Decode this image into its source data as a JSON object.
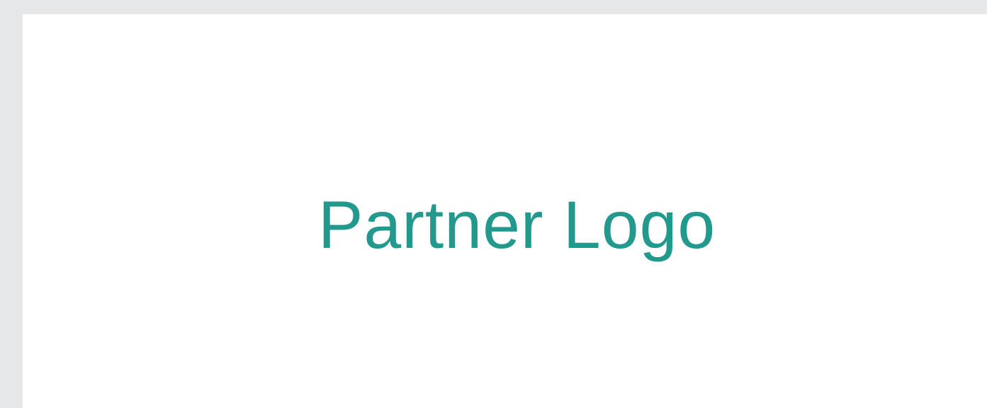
{
  "logo": {
    "text": "Partner Logo",
    "color": "#22998c"
  },
  "colors": {
    "background": "#e6e7e9",
    "card": "#ffffff"
  }
}
